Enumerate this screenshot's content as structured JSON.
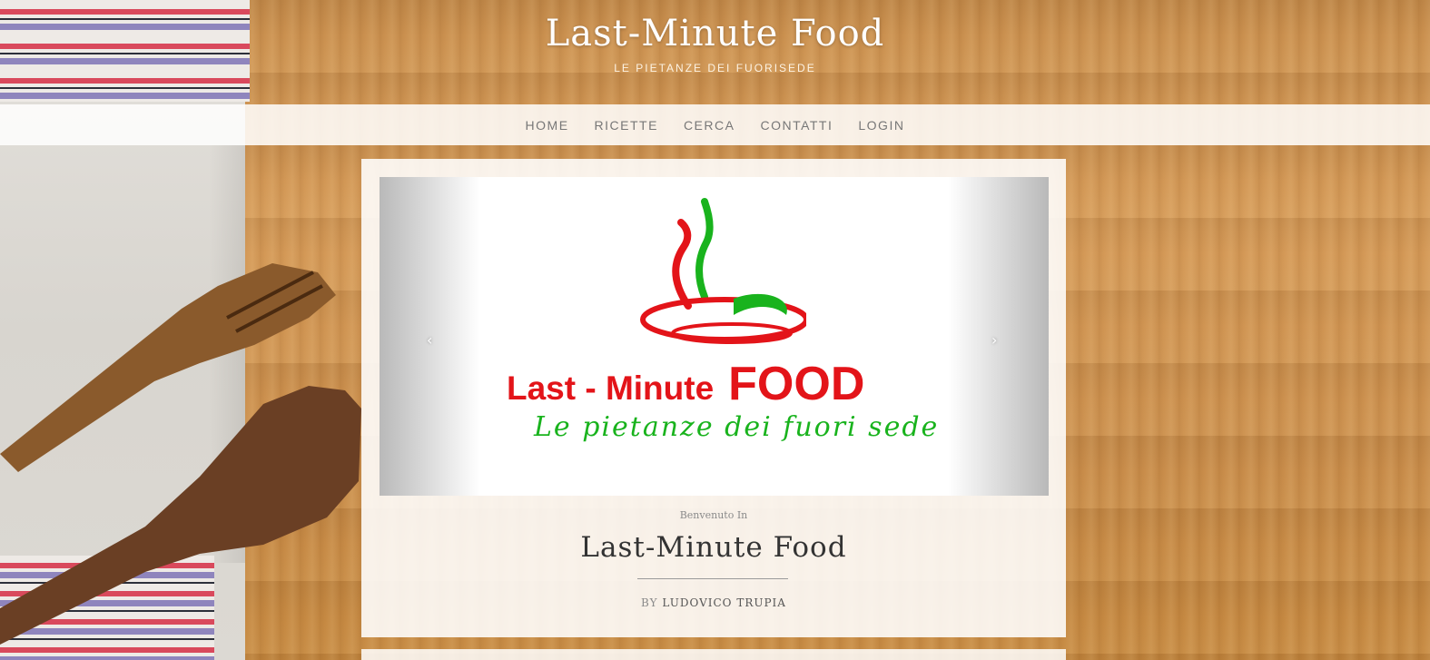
{
  "header": {
    "title": "Last-Minute Food",
    "tagline": "Le pietanze dei fuorisede"
  },
  "nav": {
    "items": [
      "HOME",
      "RICETTE",
      "CERCA",
      "CONTATTI",
      "LOGIN"
    ]
  },
  "carousel": {
    "prev_icon": "chevron-left-icon",
    "next_icon": "chevron-right-icon",
    "prev_glyph": "‹",
    "next_glyph": "›",
    "logo": {
      "main_small": "Last - Minute",
      "main_big": "FOOD",
      "script": "Le pietanze dei fuori sede",
      "colors": {
        "red": "#e31419",
        "green": "#19b31d"
      }
    }
  },
  "intro": {
    "welcome": "Benvenuto In",
    "title": "Last-Minute Food",
    "by_label": "BY",
    "author": "Ludovico Trupia"
  }
}
